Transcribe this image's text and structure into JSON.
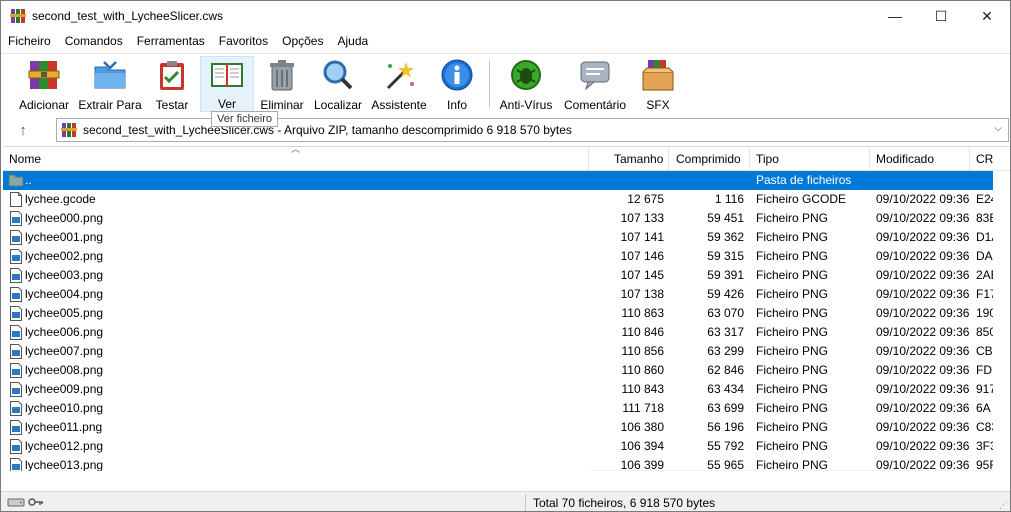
{
  "window": {
    "title": "second_test_with_LycheeSlicer.cws",
    "minimize": "—",
    "maximize": "☐",
    "close": "✕"
  },
  "menu": [
    "Ficheiro",
    "Comandos",
    "Ferramentas",
    "Favoritos",
    "Opções",
    "Ajuda"
  ],
  "toolbar": {
    "adicionar": "Adicionar",
    "extrair": "Extrair Para",
    "testar": "Testar",
    "ver": "Ver",
    "eliminar": "Eliminar",
    "localizar": "Localizar",
    "assistente": "Assistente",
    "info": "Info",
    "antivirus": "Anti-Vírus",
    "comentario": "Comentário",
    "sfx": "SFX"
  },
  "tooltip": "Ver ficheiro",
  "address": {
    "up": "↑",
    "text": "second_test_with_LycheeSlicer.cws - Arquivo ZIP, tamanho descomprimido 6 918 570 bytes",
    "dropdown": "⌵"
  },
  "columns": {
    "name": "Nome",
    "size": "Tamanho",
    "compressed": "Comprimido",
    "type": "Tipo",
    "modified": "Modificado",
    "crc": "CR"
  },
  "rows": [
    {
      "name": "..",
      "size": "",
      "comp": "",
      "type": "Pasta de ficheiros",
      "mod": "",
      "crc": "",
      "kind": "folder"
    },
    {
      "name": "lychee.gcode",
      "size": "12 675",
      "comp": "1 116",
      "type": "Ficheiro GCODE",
      "mod": "09/10/2022 09:36",
      "crc": "E24",
      "kind": "file"
    },
    {
      "name": "lychee000.png",
      "size": "107 133",
      "comp": "59 451",
      "type": "Ficheiro PNG",
      "mod": "09/10/2022 09:36",
      "crc": "83E",
      "kind": "image"
    },
    {
      "name": "lychee001.png",
      "size": "107 141",
      "comp": "59 362",
      "type": "Ficheiro PNG",
      "mod": "09/10/2022 09:36",
      "crc": "D1A",
      "kind": "image"
    },
    {
      "name": "lychee002.png",
      "size": "107 146",
      "comp": "59 315",
      "type": "Ficheiro PNG",
      "mod": "09/10/2022 09:36",
      "crc": "DA",
      "kind": "image"
    },
    {
      "name": "lychee003.png",
      "size": "107 145",
      "comp": "59 391",
      "type": "Ficheiro PNG",
      "mod": "09/10/2022 09:36",
      "crc": "2AE",
      "kind": "image"
    },
    {
      "name": "lychee004.png",
      "size": "107 138",
      "comp": "59 426",
      "type": "Ficheiro PNG",
      "mod": "09/10/2022 09:36",
      "crc": "F17",
      "kind": "image"
    },
    {
      "name": "lychee005.png",
      "size": "110 863",
      "comp": "63 070",
      "type": "Ficheiro PNG",
      "mod": "09/10/2022 09:36",
      "crc": "190",
      "kind": "image"
    },
    {
      "name": "lychee006.png",
      "size": "110 846",
      "comp": "63 317",
      "type": "Ficheiro PNG",
      "mod": "09/10/2022 09:36",
      "crc": "850",
      "kind": "image"
    },
    {
      "name": "lychee007.png",
      "size": "110 856",
      "comp": "63 299",
      "type": "Ficheiro PNG",
      "mod": "09/10/2022 09:36",
      "crc": "CB",
      "kind": "image"
    },
    {
      "name": "lychee008.png",
      "size": "110 860",
      "comp": "62 846",
      "type": "Ficheiro PNG",
      "mod": "09/10/2022 09:36",
      "crc": "FD",
      "kind": "image"
    },
    {
      "name": "lychee009.png",
      "size": "110 843",
      "comp": "63 434",
      "type": "Ficheiro PNG",
      "mod": "09/10/2022 09:36",
      "crc": "917",
      "kind": "image"
    },
    {
      "name": "lychee010.png",
      "size": "111 718",
      "comp": "63 699",
      "type": "Ficheiro PNG",
      "mod": "09/10/2022 09:36",
      "crc": "6A",
      "kind": "image"
    },
    {
      "name": "lychee011.png",
      "size": "106 380",
      "comp": "56 196",
      "type": "Ficheiro PNG",
      "mod": "09/10/2022 09:36",
      "crc": "C83",
      "kind": "image"
    },
    {
      "name": "lychee012.png",
      "size": "106 394",
      "comp": "55 792",
      "type": "Ficheiro PNG",
      "mod": "09/10/2022 09:36",
      "crc": "3F3",
      "kind": "image"
    },
    {
      "name": "lychee013.png",
      "size": "106 399",
      "comp": "55 965",
      "type": "Ficheiro PNG",
      "mod": "09/10/2022 09:36",
      "crc": "95F",
      "kind": "image"
    }
  ],
  "status": {
    "text": "Total 70 ficheiros, 6 918 570 bytes"
  },
  "colors": {
    "selection": "#0078d7",
    "antivirus": "#3aa82a",
    "info": "#1c6dd0"
  }
}
